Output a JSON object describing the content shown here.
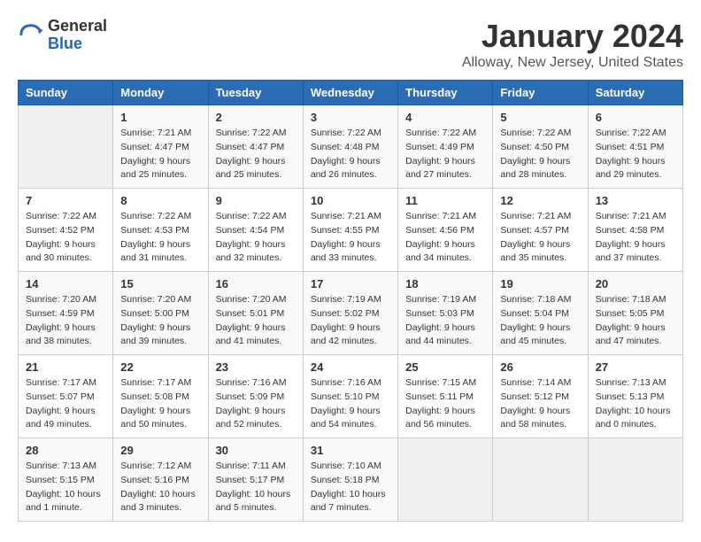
{
  "logo": {
    "general": "General",
    "blue": "Blue"
  },
  "title": "January 2024",
  "location": "Alloway, New Jersey, United States",
  "weekdays": [
    "Sunday",
    "Monday",
    "Tuesday",
    "Wednesday",
    "Thursday",
    "Friday",
    "Saturday"
  ],
  "days": [
    {
      "date": "",
      "sunrise": "",
      "sunset": "",
      "daylight": ""
    },
    {
      "date": "1",
      "sunrise": "7:21 AM",
      "sunset": "4:47 PM",
      "daylight": "9 hours and 25 minutes."
    },
    {
      "date": "2",
      "sunrise": "7:22 AM",
      "sunset": "4:47 PM",
      "daylight": "9 hours and 25 minutes."
    },
    {
      "date": "3",
      "sunrise": "7:22 AM",
      "sunset": "4:48 PM",
      "daylight": "9 hours and 26 minutes."
    },
    {
      "date": "4",
      "sunrise": "7:22 AM",
      "sunset": "4:49 PM",
      "daylight": "9 hours and 27 minutes."
    },
    {
      "date": "5",
      "sunrise": "7:22 AM",
      "sunset": "4:50 PM",
      "daylight": "9 hours and 28 minutes."
    },
    {
      "date": "6",
      "sunrise": "7:22 AM",
      "sunset": "4:51 PM",
      "daylight": "9 hours and 29 minutes."
    },
    {
      "date": "7",
      "sunrise": "7:22 AM",
      "sunset": "4:52 PM",
      "daylight": "9 hours and 30 minutes."
    },
    {
      "date": "8",
      "sunrise": "7:22 AM",
      "sunset": "4:53 PM",
      "daylight": "9 hours and 31 minutes."
    },
    {
      "date": "9",
      "sunrise": "7:22 AM",
      "sunset": "4:54 PM",
      "daylight": "9 hours and 32 minutes."
    },
    {
      "date": "10",
      "sunrise": "7:21 AM",
      "sunset": "4:55 PM",
      "daylight": "9 hours and 33 minutes."
    },
    {
      "date": "11",
      "sunrise": "7:21 AM",
      "sunset": "4:56 PM",
      "daylight": "9 hours and 34 minutes."
    },
    {
      "date": "12",
      "sunrise": "7:21 AM",
      "sunset": "4:57 PM",
      "daylight": "9 hours and 35 minutes."
    },
    {
      "date": "13",
      "sunrise": "7:21 AM",
      "sunset": "4:58 PM",
      "daylight": "9 hours and 37 minutes."
    },
    {
      "date": "14",
      "sunrise": "7:20 AM",
      "sunset": "4:59 PM",
      "daylight": "9 hours and 38 minutes."
    },
    {
      "date": "15",
      "sunrise": "7:20 AM",
      "sunset": "5:00 PM",
      "daylight": "9 hours and 39 minutes."
    },
    {
      "date": "16",
      "sunrise": "7:20 AM",
      "sunset": "5:01 PM",
      "daylight": "9 hours and 41 minutes."
    },
    {
      "date": "17",
      "sunrise": "7:19 AM",
      "sunset": "5:02 PM",
      "daylight": "9 hours and 42 minutes."
    },
    {
      "date": "18",
      "sunrise": "7:19 AM",
      "sunset": "5:03 PM",
      "daylight": "9 hours and 44 minutes."
    },
    {
      "date": "19",
      "sunrise": "7:18 AM",
      "sunset": "5:04 PM",
      "daylight": "9 hours and 45 minutes."
    },
    {
      "date": "20",
      "sunrise": "7:18 AM",
      "sunset": "5:05 PM",
      "daylight": "9 hours and 47 minutes."
    },
    {
      "date": "21",
      "sunrise": "7:17 AM",
      "sunset": "5:07 PM",
      "daylight": "9 hours and 49 minutes."
    },
    {
      "date": "22",
      "sunrise": "7:17 AM",
      "sunset": "5:08 PM",
      "daylight": "9 hours and 50 minutes."
    },
    {
      "date": "23",
      "sunrise": "7:16 AM",
      "sunset": "5:09 PM",
      "daylight": "9 hours and 52 minutes."
    },
    {
      "date": "24",
      "sunrise": "7:16 AM",
      "sunset": "5:10 PM",
      "daylight": "9 hours and 54 minutes."
    },
    {
      "date": "25",
      "sunrise": "7:15 AM",
      "sunset": "5:11 PM",
      "daylight": "9 hours and 56 minutes."
    },
    {
      "date": "26",
      "sunrise": "7:14 AM",
      "sunset": "5:12 PM",
      "daylight": "9 hours and 58 minutes."
    },
    {
      "date": "27",
      "sunrise": "7:13 AM",
      "sunset": "5:13 PM",
      "daylight": "10 hours and 0 minutes."
    },
    {
      "date": "28",
      "sunrise": "7:13 AM",
      "sunset": "5:15 PM",
      "daylight": "10 hours and 1 minute."
    },
    {
      "date": "29",
      "sunrise": "7:12 AM",
      "sunset": "5:16 PM",
      "daylight": "10 hours and 3 minutes."
    },
    {
      "date": "30",
      "sunrise": "7:11 AM",
      "sunset": "5:17 PM",
      "daylight": "10 hours and 5 minutes."
    },
    {
      "date": "31",
      "sunrise": "7:10 AM",
      "sunset": "5:18 PM",
      "daylight": "10 hours and 7 minutes."
    },
    {
      "date": "",
      "sunrise": "",
      "sunset": "",
      "daylight": ""
    },
    {
      "date": "",
      "sunrise": "",
      "sunset": "",
      "daylight": ""
    },
    {
      "date": "",
      "sunrise": "",
      "sunset": "",
      "daylight": ""
    },
    {
      "date": "",
      "sunrise": "",
      "sunset": "",
      "daylight": ""
    }
  ],
  "labels": {
    "sunrise": "Sunrise:",
    "sunset": "Sunset:",
    "daylight": "Daylight:"
  }
}
